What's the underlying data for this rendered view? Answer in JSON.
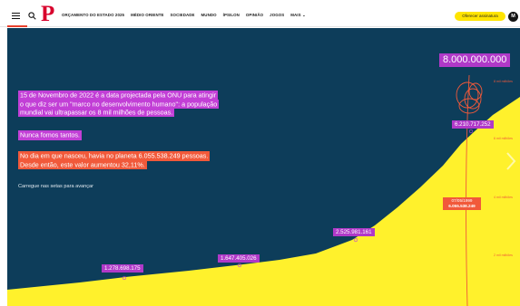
{
  "nav": {
    "items": [
      "ORÇAMENTO DO ESTADO 2025",
      "MÉDIO ORIENTE",
      "SOCIEDADE",
      "MUNDO",
      "ÍPSILON",
      "OPINIÃO",
      "JOGOS",
      "MAIS ⌄"
    ],
    "logo": "P",
    "subscribe_label": "Oferecer assinatura",
    "avatar_initial": "M",
    "accent_color": "#e8402c",
    "icons": [
      "menu-icon",
      "search-icon"
    ]
  },
  "intro": {
    "lines": [
      "15 de Novembro de 2022 é a data projectada pela ONU para atingir",
      "o que diz ser um \"marco no desenvolvimento humano\": a população",
      "mundial vai ultrapassar os 8 mil milhões de pessoas."
    ],
    "never_so_many": "Nunca fomos tantos.",
    "birth_lines": [
      "No dia em que nasceu, havia no planeta 6.055.538.249 pessoas.",
      "Desde então, este valor aumentou 32,11%."
    ],
    "hint": "Carregue nas setas para avançar"
  },
  "chart": {
    "target_label": "8.000.000.000",
    "points": [
      "1.278.698.175",
      "1.647.405.026",
      "2.525.981.161",
      "6.210.717.252"
    ],
    "birth_date": "07/05/1999",
    "birth_value": "6.055.538.249",
    "scale_labels": [
      "8 mil milhões",
      "6 mil milhões",
      "4 mil milhões",
      "2 mil milhões"
    ],
    "colors": {
      "background": "#0d3d5a",
      "area": "#fff12c",
      "accent": "#c23fd6",
      "highlight": "#f1593a"
    }
  }
}
